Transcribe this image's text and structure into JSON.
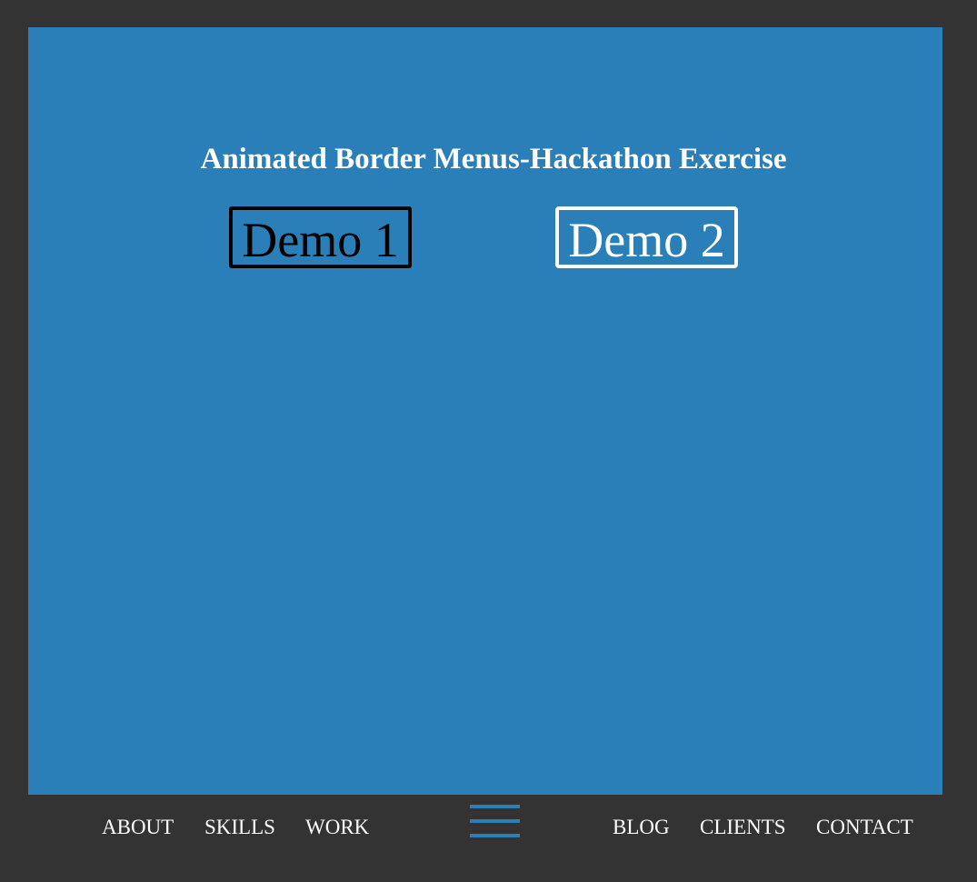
{
  "header": {
    "title": "Animated Border Menus-Hackathon Exercise"
  },
  "demos": [
    {
      "label": "Demo 1"
    },
    {
      "label": "Demo 2"
    }
  ],
  "nav": {
    "left": [
      {
        "label": "ABOUT"
      },
      {
        "label": "SKILLS"
      },
      {
        "label": "WORK"
      }
    ],
    "right": [
      {
        "label": "BLOG"
      },
      {
        "label": "CLIENTS"
      },
      {
        "label": "CONTACT"
      }
    ],
    "menu_icon": "hamburger-menu-icon"
  },
  "colors": {
    "background": "#333333",
    "panel": "#2a7fb8",
    "demo1_border": "#000000",
    "demo2_border": "#ffffff",
    "text": "#ffffff"
  }
}
